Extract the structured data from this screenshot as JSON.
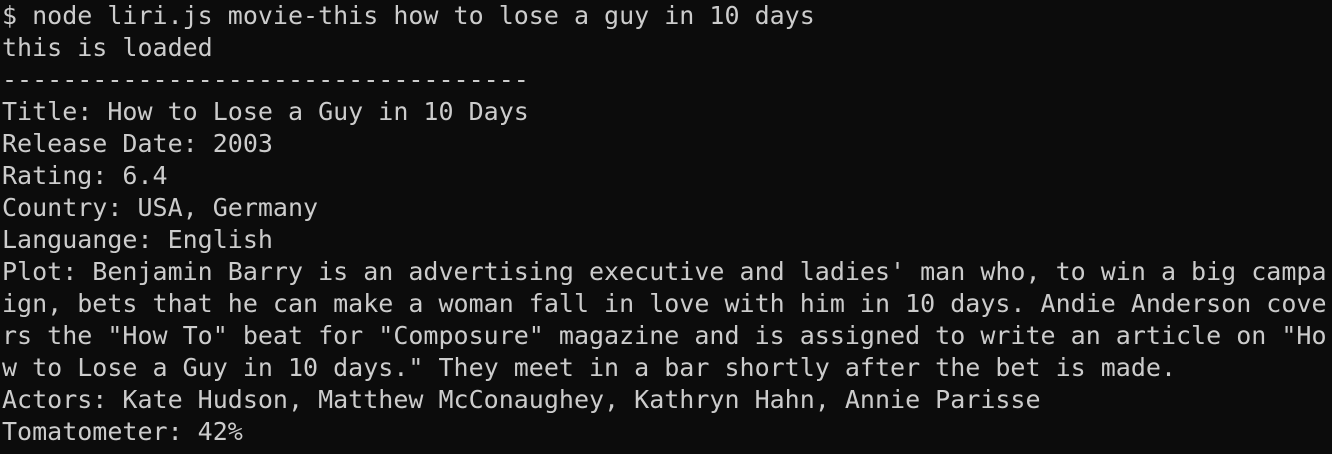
{
  "terminal": {
    "lines": [
      "$ node liri.js movie-this how to lose a guy in 10 days",
      "this is loaded",
      "-----------------------------------",
      "Title: How to Lose a Guy in 10 Days",
      "Release Date: 2003",
      "Rating: 6.4",
      "Country: USA, Germany",
      "Languange: English",
      "Plot: Benjamin Barry is an advertising executive and ladies' man who, to win a big campa",
      "ign, bets that he can make a woman fall in love with him in 10 days. Andie Anderson cove",
      "rs the \"How To\" beat for \"Composure\" magazine and is assigned to write an article on \"Ho",
      "w to Lose a Guy in 10 days.\" They meet in a bar shortly after the bet is made.",
      "Actors: Kate Hudson, Matthew McConaughey, Kathryn Hahn, Annie Parisse",
      "Tomatometer: 42%"
    ]
  },
  "colors": {
    "background": "#0c0c0c",
    "text": "#cccccc"
  }
}
